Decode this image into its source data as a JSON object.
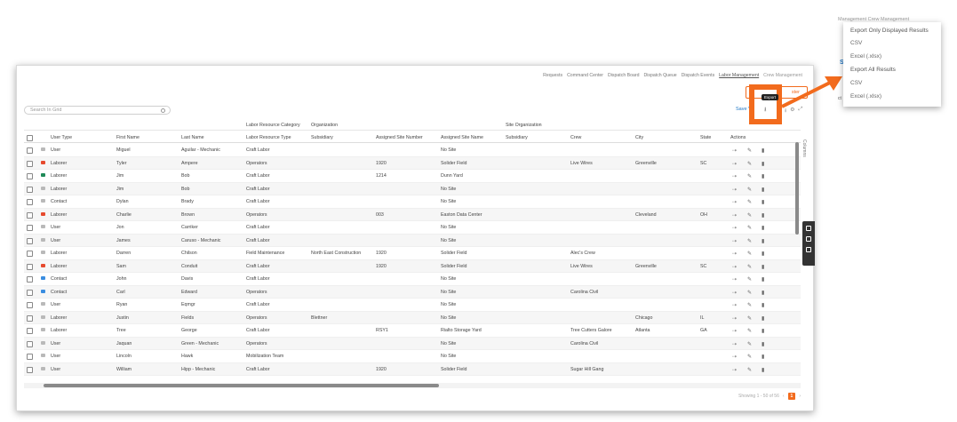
{
  "nav": {
    "items": [
      "Requests",
      "Command Center",
      "Dispatch Board",
      "Dispatch Queue",
      "Dispatch Events",
      "Labor Management",
      "Crew Management"
    ]
  },
  "primary_button": {
    "label": "ster"
  },
  "search": {
    "placeholder": "Search In Grid"
  },
  "toolbar": {
    "save_view": "Save V",
    "export_tooltip": "Export"
  },
  "group_headers": {
    "labor_resource_category": "Labor Resource Category",
    "organization": "Organization",
    "site_organization": "Site Organization"
  },
  "columns": [
    "User Type",
    "First Name",
    "Last Name",
    "Labor Resource Type",
    "Subsidiary",
    "Assigned Site Number",
    "Assigned Site Name",
    "Subsidiary",
    "Crew",
    "City",
    "State",
    "Actions"
  ],
  "rows": [
    {
      "icon": "user",
      "type": "User",
      "first": "Miguel",
      "last": "Aguilar - Mechanic",
      "labor": "Craft Labor",
      "sub": "",
      "site_num": "",
      "site_name": "No Site",
      "sub2": "",
      "crew": "",
      "city": "",
      "state": ""
    },
    {
      "icon": "laborer-red",
      "type": "Laborer",
      "first": "Tyler",
      "last": "Ampere",
      "labor": "Operators",
      "sub": "",
      "site_num": "1920",
      "site_name": "Solider Field",
      "sub2": "",
      "crew": "Live Wires",
      "city": "Greenville",
      "state": "SC"
    },
    {
      "icon": "laborer-green",
      "type": "Laborer",
      "first": "Jim",
      "last": "Bob",
      "labor": "Craft Labor",
      "sub": "",
      "site_num": "1214",
      "site_name": "Dunn Yard",
      "sub2": "",
      "crew": "",
      "city": "",
      "state": ""
    },
    {
      "icon": "user",
      "type": "Laborer",
      "first": "Jim",
      "last": "Bob",
      "labor": "Craft Labor",
      "sub": "",
      "site_num": "",
      "site_name": "No Site",
      "sub2": "",
      "crew": "",
      "city": "",
      "state": ""
    },
    {
      "icon": "user",
      "type": "Contact",
      "first": "Dylan",
      "last": "Brady",
      "labor": "Craft Labor",
      "sub": "",
      "site_num": "",
      "site_name": "No Site",
      "sub2": "",
      "crew": "",
      "city": "",
      "state": ""
    },
    {
      "icon": "laborer-red",
      "type": "Laborer",
      "first": "Charlie",
      "last": "Brown",
      "labor": "Operators",
      "sub": "",
      "site_num": "003",
      "site_name": "Easton Data Center",
      "sub2": "",
      "crew": "",
      "city": "Cleveland",
      "state": "OH"
    },
    {
      "icon": "user",
      "type": "User",
      "first": "Jon",
      "last": "Carriker",
      "labor": "Craft Labor",
      "sub": "",
      "site_num": "",
      "site_name": "No Site",
      "sub2": "",
      "crew": "",
      "city": "",
      "state": ""
    },
    {
      "icon": "user",
      "type": "User",
      "first": "James",
      "last": "Caruso - Mechanic",
      "labor": "Craft Labor",
      "sub": "",
      "site_num": "",
      "site_name": "No Site",
      "sub2": "",
      "crew": "",
      "city": "",
      "state": ""
    },
    {
      "icon": "user",
      "type": "Laborer",
      "first": "Darren",
      "last": "Chilson",
      "labor": "Field Maintenance",
      "sub": "North East Construction",
      "site_num": "1920",
      "site_name": "Solider Field",
      "sub2": "",
      "crew": "Alec's Crew",
      "city": "",
      "state": ""
    },
    {
      "icon": "laborer-red",
      "type": "Laborer",
      "first": "Sam",
      "last": "Conduit",
      "labor": "Craft Labor",
      "sub": "",
      "site_num": "1920",
      "site_name": "Solider Field",
      "sub2": "",
      "crew": "Live Wires",
      "city": "Greenville",
      "state": "SC"
    },
    {
      "icon": "contact",
      "type": "Contact",
      "first": "John",
      "last": "Davis",
      "labor": "Craft Labor",
      "sub": "",
      "site_num": "",
      "site_name": "No Site",
      "sub2": "",
      "crew": "",
      "city": "",
      "state": ""
    },
    {
      "icon": "contact",
      "type": "Contact",
      "first": "Carl",
      "last": "Edward",
      "labor": "Operators",
      "sub": "",
      "site_num": "",
      "site_name": "No Site",
      "sub2": "",
      "crew": "Carolina Civil",
      "city": "",
      "state": ""
    },
    {
      "icon": "user",
      "type": "User",
      "first": "Ryan",
      "last": "Eqmgr",
      "labor": "Craft Labor",
      "sub": "",
      "site_num": "",
      "site_name": "No Site",
      "sub2": "",
      "crew": "",
      "city": "",
      "state": ""
    },
    {
      "icon": "user",
      "type": "Laborer",
      "first": "Justin",
      "last": "Fields",
      "labor": "Operators",
      "sub": "Blettner",
      "site_num": "",
      "site_name": "No Site",
      "sub2": "",
      "crew": "",
      "city": "Chicago",
      "state": "IL"
    },
    {
      "icon": "user",
      "type": "Laborer",
      "first": "Tree",
      "last": "George",
      "labor": "Craft Labor",
      "sub": "",
      "site_num": "RSY1",
      "site_name": "Rialto Storage Yard",
      "sub2": "",
      "crew": "Tree Cutters Galore",
      "city": "Atlanta",
      "state": "GA"
    },
    {
      "icon": "user",
      "type": "User",
      "first": "Jaquan",
      "last": "Green - Mechanic",
      "labor": "Operators",
      "sub": "",
      "site_num": "",
      "site_name": "No Site",
      "sub2": "",
      "crew": "Carolina Civil",
      "city": "",
      "state": ""
    },
    {
      "icon": "user",
      "type": "User",
      "first": "Lincoln",
      "last": "Hawk",
      "labor": "Mobilization Team",
      "sub": "",
      "site_num": "",
      "site_name": "No Site",
      "sub2": "",
      "crew": "",
      "city": "",
      "state": ""
    },
    {
      "icon": "user",
      "type": "User",
      "first": "William",
      "last": "Hipp - Mechanic",
      "labor": "Craft Labor",
      "sub": "",
      "site_num": "1920",
      "site_name": "Solider Field",
      "sub2": "",
      "crew": "Sugar Hill Gang",
      "city": "",
      "state": ""
    }
  ],
  "side_label": "Columns",
  "pager": {
    "summary": "Showing 1 - 50 of 56",
    "current": "1"
  },
  "popup": {
    "tabs": "Management  Crew Management",
    "s_label": "S",
    "side_ellipsis": "ct",
    "items": [
      {
        "label": "Export Only Displayed Results",
        "heading": true
      },
      {
        "label": "CSV",
        "heading": false
      },
      {
        "label": "Excel (.xlsx)",
        "heading": false
      },
      {
        "label": "Export All Results",
        "heading": true
      },
      {
        "label": "CSV",
        "heading": false
      },
      {
        "label": "Excel (.xlsx)",
        "heading": false
      }
    ]
  },
  "colors": {
    "accent": "#f26b1d",
    "link": "#1b74c5",
    "laborer_red": "#e64a2e",
    "laborer_green": "#1f8a58",
    "contact_blue": "#3a8de0"
  }
}
